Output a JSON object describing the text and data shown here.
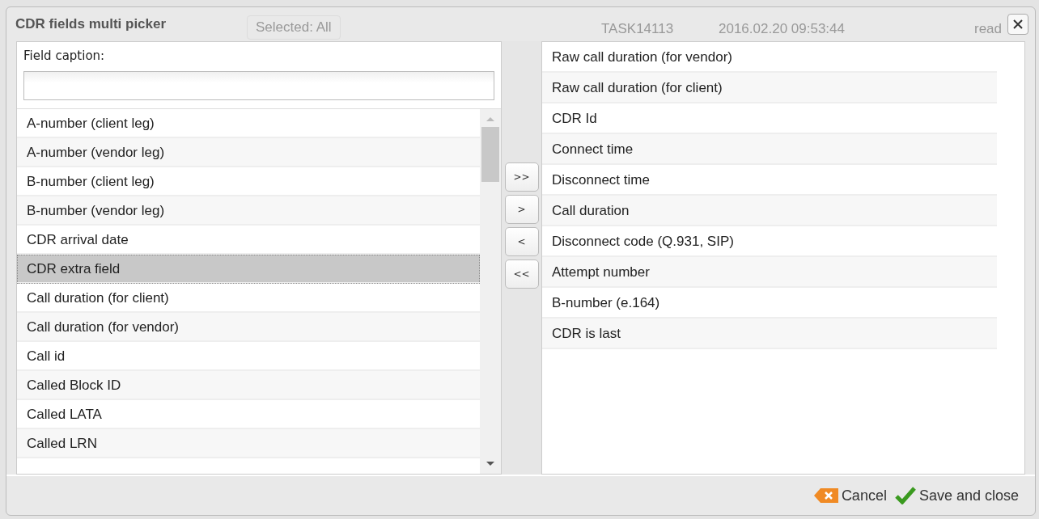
{
  "background": {
    "filter": "Selected: All",
    "task": "TASK14113",
    "date": "2016.02.20 09:53:44",
    "status": "read"
  },
  "window": {
    "title": "CDR fields multi picker"
  },
  "search": {
    "label": "Field caption:"
  },
  "available": [
    {
      "label": "A-number (client leg)",
      "selected": false
    },
    {
      "label": "A-number (vendor leg)",
      "selected": false
    },
    {
      "label": "B-number (client leg)",
      "selected": false
    },
    {
      "label": "B-number (vendor leg)",
      "selected": false
    },
    {
      "label": "CDR arrival date",
      "selected": false
    },
    {
      "label": "CDR extra field",
      "selected": true
    },
    {
      "label": "Call duration (for client)",
      "selected": false
    },
    {
      "label": "Call duration (for vendor)",
      "selected": false
    },
    {
      "label": "Call id",
      "selected": false
    },
    {
      "label": "Called Block ID",
      "selected": false
    },
    {
      "label": "Called LATA",
      "selected": false
    },
    {
      "label": "Called LRN",
      "selected": false
    }
  ],
  "move_buttons": [
    ">>",
    ">",
    "<",
    "<<"
  ],
  "chosen": [
    {
      "label": "Raw call duration (for vendor)",
      "selected": false
    },
    {
      "label": "Raw call duration (for client)",
      "selected": false
    },
    {
      "label": "CDR Id",
      "selected": false
    },
    {
      "label": "Connect time",
      "selected": false
    },
    {
      "label": "Disconnect time",
      "selected": false
    },
    {
      "label": "Call duration",
      "selected": false
    },
    {
      "label": "Disconnect code (Q.931, SIP)",
      "selected": false
    },
    {
      "label": "Attempt number",
      "selected": false
    },
    {
      "label": "B-number (e.164)",
      "selected": false
    },
    {
      "label": "CDR is last",
      "selected": false
    }
  ],
  "buttons": [
    {
      "kind": "cancel",
      "label": "Cancel"
    },
    {
      "kind": "save",
      "label": "Save and close"
    }
  ]
}
